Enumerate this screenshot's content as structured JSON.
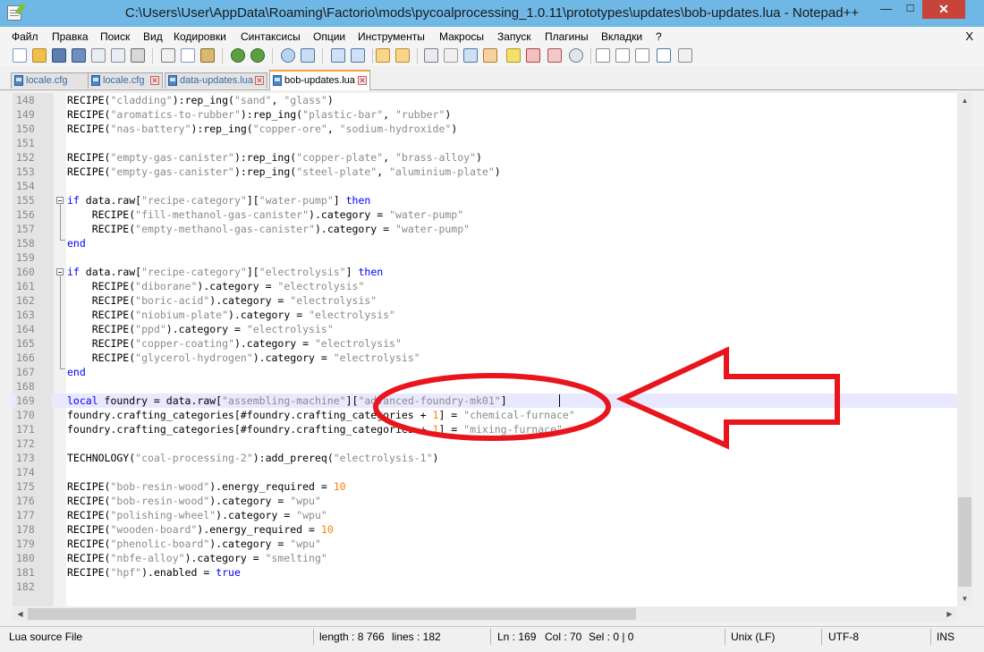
{
  "window": {
    "title": "C:\\Users\\User\\AppData\\Roaming\\Factorio\\mods\\pycoalprocessing_1.0.11\\prototypes\\updates\\bob-updates.lua - Notepad++",
    "minimize": "—",
    "maximize": "☐",
    "close": "✕"
  },
  "menu": {
    "items": [
      "Файл",
      "Правка",
      "Поиск",
      "Вид",
      "Кодировки",
      "Синтаксисы",
      "Опции",
      "Инструменты",
      "Макросы",
      "Запуск",
      "Плагины",
      "Вкладки",
      "?"
    ],
    "close": "X"
  },
  "tabs": [
    {
      "label": "locale.cfg",
      "active": false
    },
    {
      "label": "locale.cfg",
      "active": false
    },
    {
      "label": "data-updates.lua",
      "active": false
    },
    {
      "label": "bob-updates.lua",
      "active": true
    }
  ],
  "editor": {
    "lines": [
      {
        "n": "148",
        "code": "RECIPE(\"cladding\"):rep_ing(\"sand\", \"glass\")"
      },
      {
        "n": "149",
        "code": "RECIPE(\"aromatics-to-rubber\"):rep_ing(\"plastic-bar\", \"rubber\")"
      },
      {
        "n": "150",
        "code": "RECIPE(\"nas-battery\"):rep_ing(\"copper-ore\", \"sodium-hydroxide\")"
      },
      {
        "n": "151",
        "code": ""
      },
      {
        "n": "152",
        "code": "RECIPE(\"empty-gas-canister\"):rep_ing(\"copper-plate\", \"brass-alloy\")"
      },
      {
        "n": "153",
        "code": "RECIPE(\"empty-gas-canister\"):rep_ing(\"steel-plate\", \"aluminium-plate\")"
      },
      {
        "n": "154",
        "code": ""
      },
      {
        "n": "155",
        "code": "if data.raw[\"recipe-category\"][\"water-pump\"] then"
      },
      {
        "n": "156",
        "code": "    RECIPE(\"fill-methanol-gas-canister\").category = \"water-pump\""
      },
      {
        "n": "157",
        "code": "    RECIPE(\"empty-methanol-gas-canister\").category = \"water-pump\""
      },
      {
        "n": "158",
        "code": "end"
      },
      {
        "n": "159",
        "code": ""
      },
      {
        "n": "160",
        "code": "if data.raw[\"recipe-category\"][\"electrolysis\"] then"
      },
      {
        "n": "161",
        "code": "    RECIPE(\"diborane\").category = \"electrolysis\""
      },
      {
        "n": "162",
        "code": "    RECIPE(\"boric-acid\").category = \"electrolysis\""
      },
      {
        "n": "163",
        "code": "    RECIPE(\"niobium-plate\").category = \"electrolysis\""
      },
      {
        "n": "164",
        "code": "    RECIPE(\"ppd\").category = \"electrolysis\""
      },
      {
        "n": "165",
        "code": "    RECIPE(\"copper-coating\").category = \"electrolysis\""
      },
      {
        "n": "166",
        "code": "    RECIPE(\"glycerol-hydrogen\").category = \"electrolysis\""
      },
      {
        "n": "167",
        "code": "end"
      },
      {
        "n": "168",
        "code": ""
      },
      {
        "n": "169",
        "code": "local foundry = data.raw[\"assembling-machine\"][\"advanced-foundry-mk01\"]"
      },
      {
        "n": "170",
        "code": "foundry.crafting_categories[#foundry.crafting_categories + 1] = \"chemical-furnace\""
      },
      {
        "n": "171",
        "code": "foundry.crafting_categories[#foundry.crafting_categories + 1] = \"mixing-furnace\""
      },
      {
        "n": "172",
        "code": ""
      },
      {
        "n": "173",
        "code": "TECHNOLOGY(\"coal-processing-2\"):add_prereq(\"electrolysis-1\")"
      },
      {
        "n": "174",
        "code": ""
      },
      {
        "n": "175",
        "code": "RECIPE(\"bob-resin-wood\").energy_required = 10"
      },
      {
        "n": "176",
        "code": "RECIPE(\"bob-resin-wood\").category = \"wpu\""
      },
      {
        "n": "177",
        "code": "RECIPE(\"polishing-wheel\").category = \"wpu\""
      },
      {
        "n": "178",
        "code": "RECIPE(\"wooden-board\").energy_required = 10"
      },
      {
        "n": "179",
        "code": "RECIPE(\"phenolic-board\").category = \"wpu\""
      },
      {
        "n": "180",
        "code": "RECIPE(\"nbfe-alloy\").category = \"smelting\""
      },
      {
        "n": "181",
        "code": "RECIPE(\"hpf\").enabled = true"
      },
      {
        "n": "182",
        "code": ""
      }
    ],
    "current_line": "169",
    "syntax_colors": {
      "string": "#8a8a8a",
      "keyword": "#0000ff",
      "number": "#ff8000"
    }
  },
  "status": {
    "file_type": "Lua source File",
    "length": "length : 8 766",
    "lines": "lines : 182",
    "ln": "Ln : 169",
    "col": "Col : 70",
    "sel": "Sel : 0 | 0",
    "eol": "Unix (LF)",
    "encoding": "UTF-8",
    "mode": "INS"
  },
  "annotation": {
    "color": "#e8151c"
  }
}
